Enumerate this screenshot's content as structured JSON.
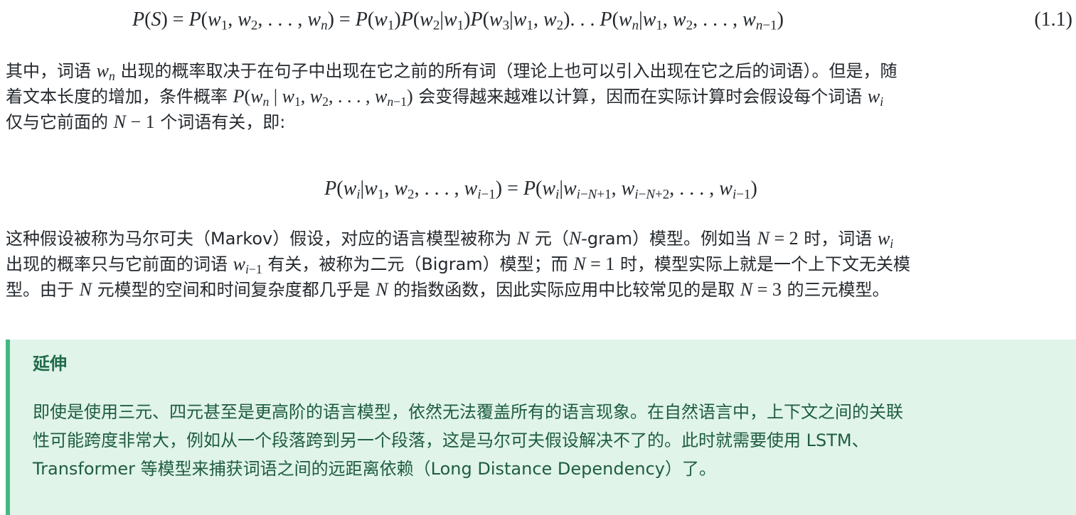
{
  "equation_1": {
    "number": "(1.1)"
  },
  "paragraph_1": {
    "line1_a": "其中，词语 ",
    "line1_b": " 出现的概率取决于在句子中出现在它之前的所有词（理论上也可以引入出现在它之后的词语）。但是，随",
    "line2_a": "着文本长度的增加，条件概率 ",
    "line2_b": " 会变得越来越难以计算，因而在实际计算时会假设每个词语 ",
    "line3_a": "仅与它前面的 ",
    "line3_b": " 个词语有关，即:"
  },
  "paragraph_2": {
    "line1_a": "这种假设被称为马尔可夫（Markov）假设，对应的语言模型被称为 ",
    "line1_b": " 元（",
    "line1_c": "-gram）模型。例如当 ",
    "line1_d": " 时，词语 ",
    "line2_a": "出现的概率只与它前面的词语 ",
    "line2_b": " 有关，被称为二元（Bigram）模型；而 ",
    "line2_c": " 时，模型实际上就是一个上下文无关模",
    "line3_a": "型。由于 ",
    "line3_b": " 元模型的空间和时间复杂度都几乎是 ",
    "line3_c": " 的指数函数，因此实际应用中比较常见的是取 ",
    "line3_d": " 的三元模型。"
  },
  "callout": {
    "title": "延伸",
    "line1": "即使是使用三元、四元甚至是更高阶的语言模型，依然无法覆盖所有的语言现象。在自然语言中，上下文之间的关联",
    "line2": "性可能跨度非常大，例如从一个段落跨到另一个段落，这是马尔可夫假设解决不了的。此时就需要使用 LSTM、",
    "line3": "Transformer 等模型来捕获词语之间的远距离依赖（Long Distance Dependency）了。"
  },
  "colors": {
    "callout_bg": "#e0f4ea",
    "callout_border": "#42b983",
    "callout_text": "#1f5d3f"
  }
}
